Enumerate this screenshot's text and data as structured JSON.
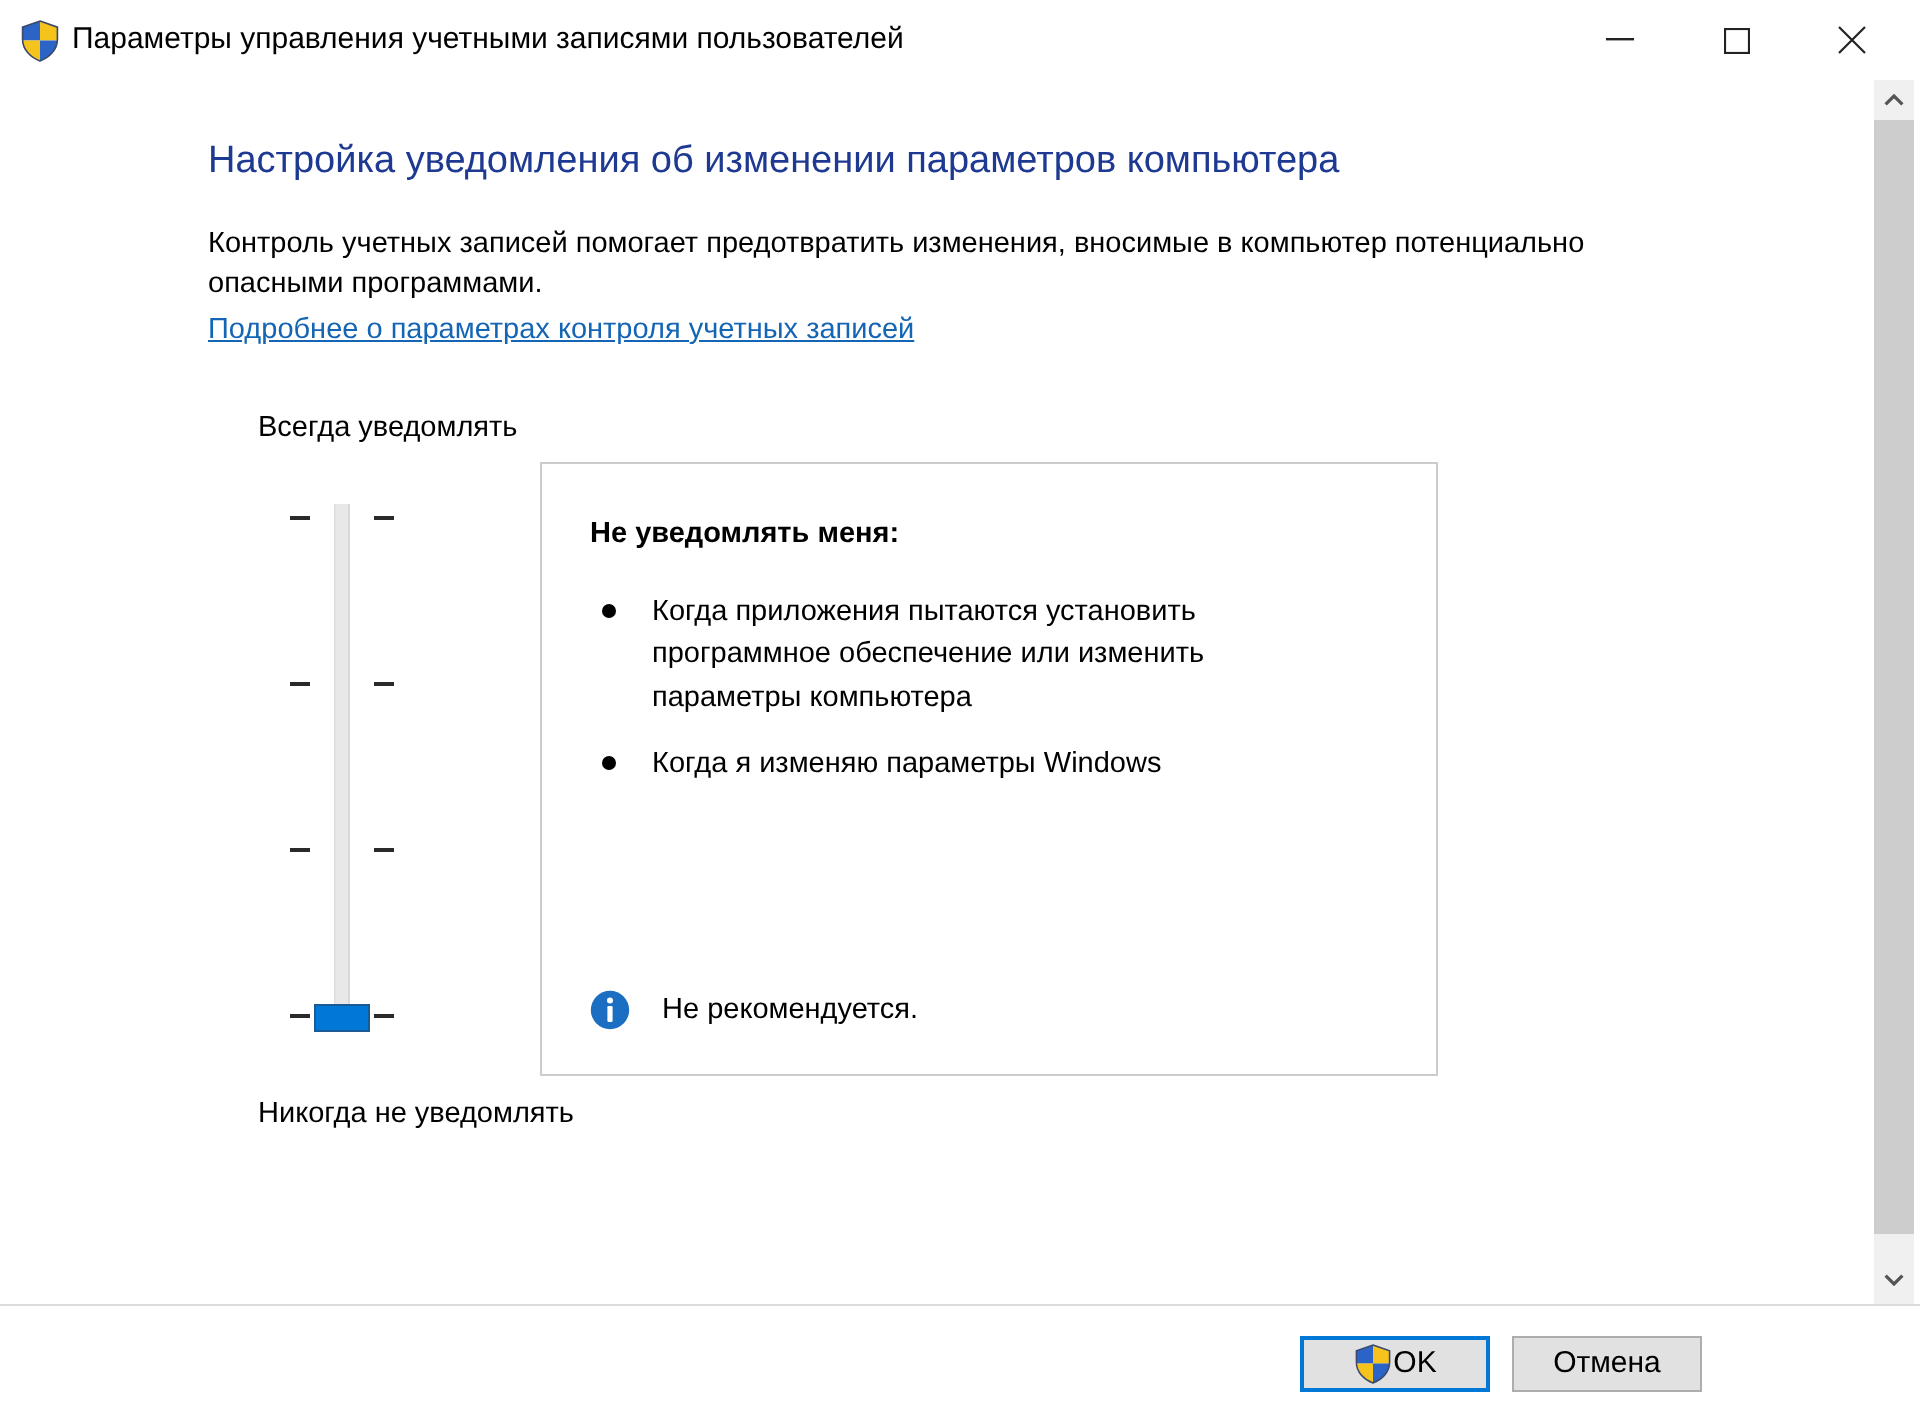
{
  "window": {
    "title": "Параметры управления учетными записями пользователей"
  },
  "heading": "Настройка уведомления об изменении параметров компьютера",
  "description": "Контроль учетных записей помогает предотвратить изменения, вносимые в компьютер потенциально опасными программами.",
  "link": "Подробнее о параметрах контроля учетных записей",
  "slider": {
    "top_label": "Всегда уведомлять",
    "bottom_label": "Никогда не уведомлять",
    "level": 0
  },
  "info_panel": {
    "title": "Не уведомлять меня:",
    "bullets": [
      "Когда приложения пытаются установить программное обеспечение или изменить параметры компьютера",
      "Когда я изменяю параметры Windows"
    ],
    "note": "Не рекомендуется."
  },
  "buttons": [
    {
      "label": "OK",
      "shield": true,
      "default": true
    },
    {
      "label": "Отмена",
      "shield": false,
      "default": false
    }
  ]
}
